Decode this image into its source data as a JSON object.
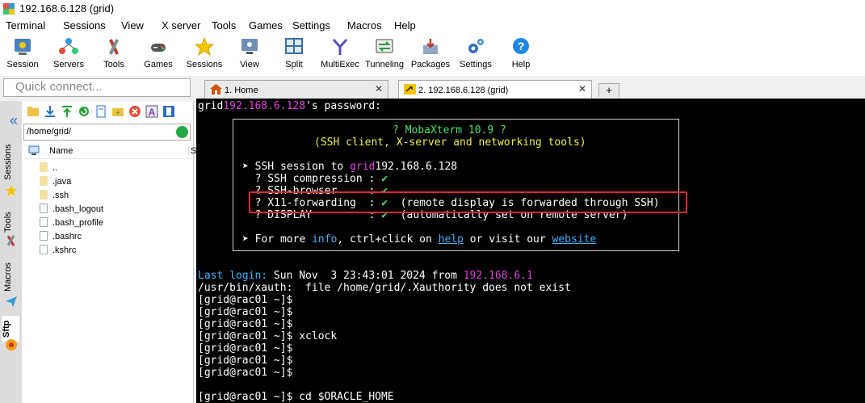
{
  "window": {
    "title": "192.168.6.128 (grid)"
  },
  "menu": [
    "Terminal",
    "Sessions",
    "View",
    "X server",
    "Tools",
    "Games",
    "Settings",
    "Macros",
    "Help"
  ],
  "toolbar": [
    "Session",
    "Servers",
    "Tools",
    "Games",
    "Sessions",
    "View",
    "Split",
    "MultiExec",
    "Tunneling",
    "Packages",
    "Settings",
    "Help"
  ],
  "quick_connect": {
    "placeholder": "Quick connect..."
  },
  "tabs": {
    "home": "1. Home",
    "session": "2. 192.168.6.128 (grid)",
    "close": "✕",
    "add": "+"
  },
  "side_tabs": {
    "sessions": "Sessions",
    "tools": "Tools",
    "macros": "Macros",
    "sftp": "Sftp"
  },
  "sftp": {
    "path": "/home/grid/",
    "column_name": "Name",
    "column_size": "S",
    "files": [
      "..",
      ".java",
      ".ssh",
      ".bash_logout",
      ".bash_profile",
      ".bashrc",
      ".kshrc"
    ]
  },
  "terminal": {
    "prompt_user": "grid",
    "host": "192.168.6.128",
    "password_suffix": "'s password:",
    "banner_title": "? MobaXterm 10.9 ?",
    "banner_subtitle": "(SSH client, X-server and networking tools)",
    "ssh_session_prefix": "➤ SSH session to ",
    "ssh_compression": "  ? SSH compression : ",
    "ssh_browser": "  ? SSH-browser     : ",
    "x11_forwarding": "  ? X11-forwarding  : ",
    "x11_note": "  (remote display is forwarded through SSH)",
    "display": "  ? DISPLAY         : ",
    "display_note": "  (automatically set on remote server)",
    "check": "✔",
    "info_prefix": "➤ For more ",
    "info_word": "info",
    "info_mid": ", ctrl+click on ",
    "help_word": "help",
    "info_or": " or visit our ",
    "website_word": "website",
    "last_login_label": "Last login:",
    "last_login_text": " Sun Nov  3 23:43:01 2024 from ",
    "last_login_ip": "192.168.6.1",
    "xauth_line": "/usr/bin/xauth:  file /home/grid/.Xauthority does not exist",
    "lines": [
      "[grid@rac01 ~]$",
      "[grid@rac01 ~]$",
      "[grid@rac01 ~]$",
      "[grid@rac01 ~]$ xclock",
      "[grid@rac01 ~]$",
      "[grid@rac01 ~]$",
      "[grid@rac01 ~]$",
      "[grid@rac01 ~]$ cd $ORACLE_HOME"
    ]
  }
}
